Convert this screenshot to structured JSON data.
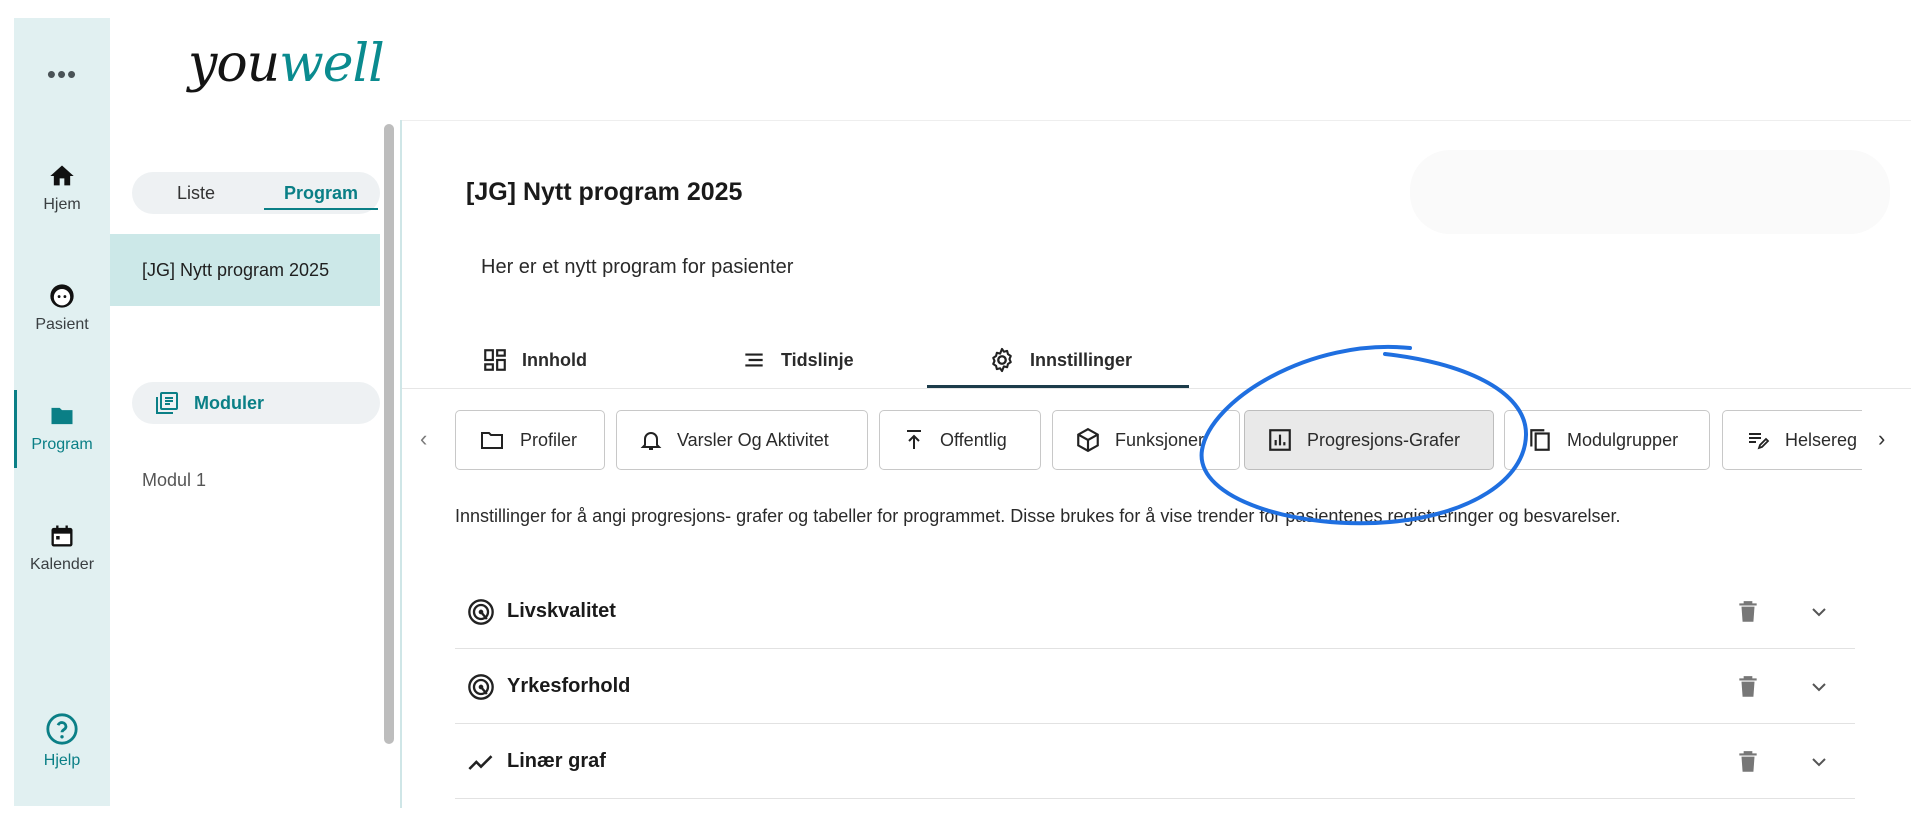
{
  "app": {
    "logo_part1": "you",
    "logo_part2": "well",
    "more": "•••"
  },
  "rail": {
    "items": [
      {
        "label": "Hjem",
        "icon": "home-icon"
      },
      {
        "label": "Pasient",
        "icon": "face-icon"
      },
      {
        "label": "Program",
        "icon": "folder-icon",
        "active": true
      },
      {
        "label": "Kalender",
        "icon": "calendar-icon"
      }
    ],
    "help": {
      "label": "Hjelp",
      "icon": "help-circle-icon"
    }
  },
  "sidebar": {
    "toggle": {
      "liste": "Liste",
      "program": "Program",
      "selected": "Program"
    },
    "program_item": "[JG] Nytt program 2025",
    "modules_label": "Moduler",
    "module_items": [
      "Modul 1"
    ]
  },
  "main": {
    "title": "[JG] Nytt program 2025",
    "description": "Her er et nytt program for pasienter",
    "tabs": [
      {
        "label": "Innhold",
        "icon": "dashboard-icon"
      },
      {
        "label": "Tidslinje",
        "icon": "timeline-icon"
      },
      {
        "label": "Innstillinger",
        "icon": "gear-icon",
        "active": true
      }
    ],
    "chips": [
      {
        "label": "Profiler",
        "icon": "folder-outline-icon"
      },
      {
        "label": "Varsler Og Aktivitet",
        "icon": "bell-icon"
      },
      {
        "label": "Offentlig",
        "icon": "publish-icon"
      },
      {
        "label": "Funksjoner",
        "icon": "cube-icon"
      },
      {
        "label": "Progresjons-Grafer",
        "icon": "bar-chart-icon",
        "active": true
      },
      {
        "label": "Modulgrupper",
        "icon": "copy-icon"
      },
      {
        "label": "Helsereg",
        "icon": "edit-note-icon"
      }
    ],
    "info_text": "Innstillinger for å angi progresjons- grafer og tabeller for programmet. Disse brukes for å vise trender for pasientenes registreringer og besvarelser.",
    "rows": [
      {
        "label": "Livskvalitet",
        "icon": "radar-icon"
      },
      {
        "label": "Yrkesforhold",
        "icon": "radar-icon"
      },
      {
        "label": "Linær graf",
        "icon": "line-chart-icon"
      }
    ]
  },
  "colors": {
    "accent": "#0a7f86",
    "rail_bg": "#e1f0f1",
    "annotation": "#1f6fe0"
  }
}
